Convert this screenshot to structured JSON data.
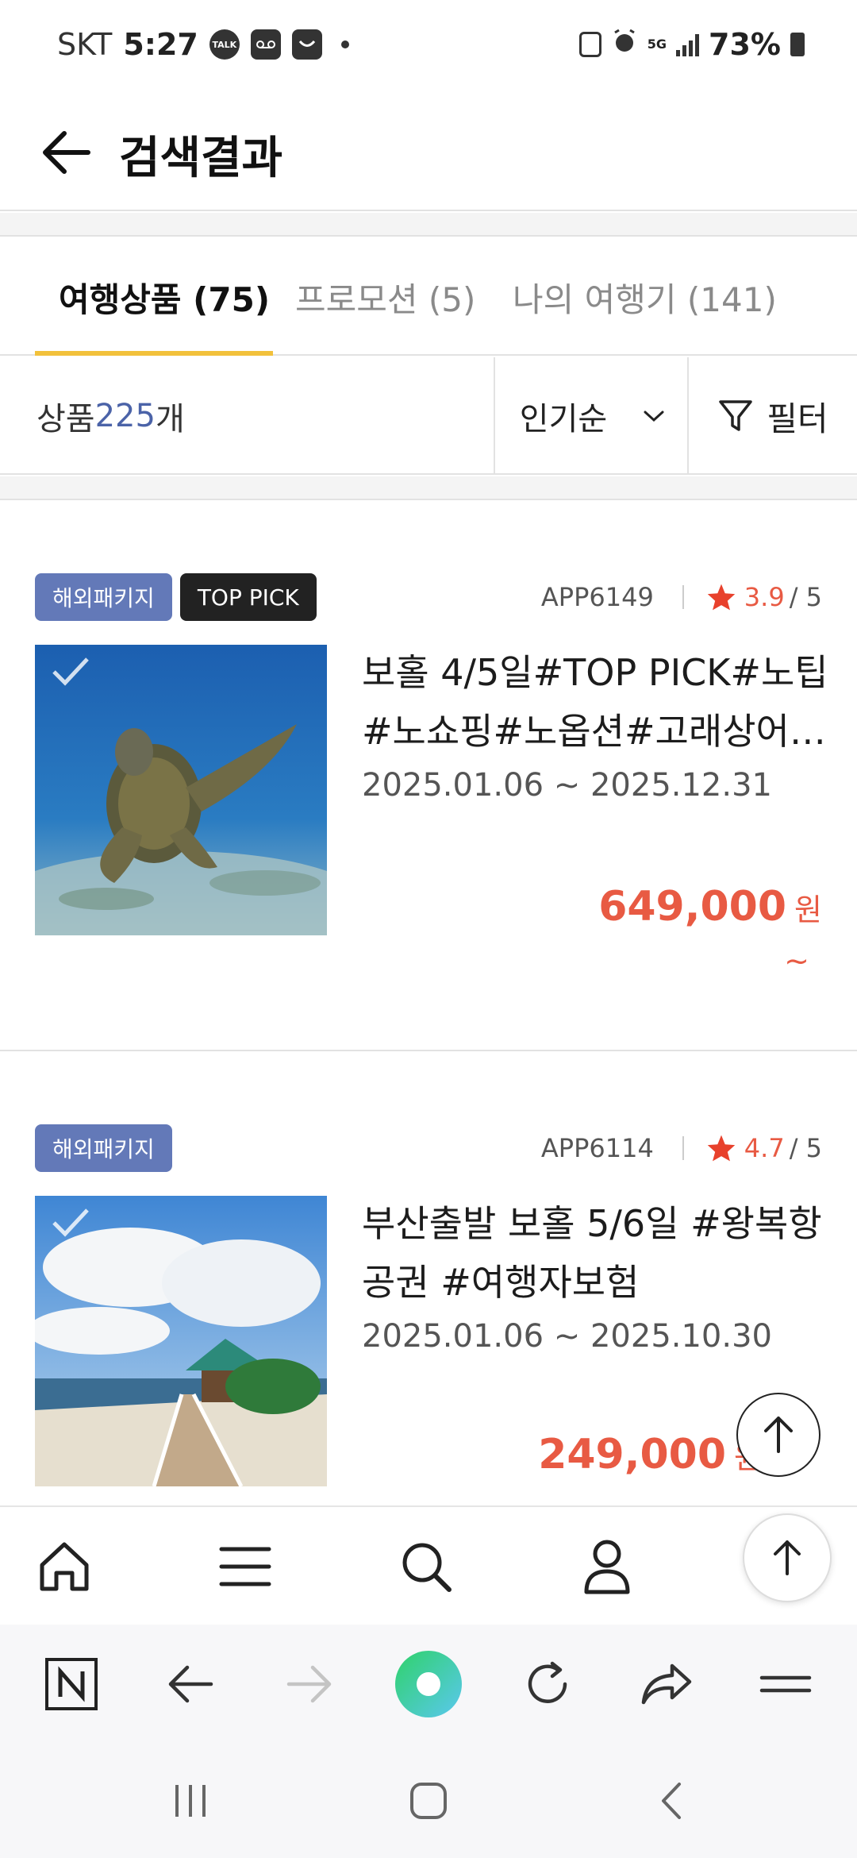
{
  "status_bar": {
    "carrier": "SKT",
    "time": "5:27",
    "talk_icon_text": "TALK",
    "network": "5G",
    "battery": "73%"
  },
  "header": {
    "title": "검색결과"
  },
  "tabs": [
    {
      "label": "여행상품 (75)",
      "active": true
    },
    {
      "label": "프로모션 (5)",
      "active": false
    },
    {
      "label": "나의 여행기 (141)",
      "active": false
    }
  ],
  "controls": {
    "count_prefix": "상품 ",
    "count_value": "225",
    "count_suffix": "개",
    "sort_label": "인기순",
    "filter_label": "필터"
  },
  "products": [
    {
      "badges": [
        "해외패키지",
        "TOP PICK"
      ],
      "code": "APP6149",
      "rating": "3.9",
      "rating_max": "/ 5",
      "title_line1": "보홀 4/5일#TOP PICK#노팁",
      "title_line2": "#노쇼핑#노옵션#고래상어…",
      "dates": "2025.01.06 ~ 2025.12.31",
      "price": "649,000",
      "currency": "원",
      "price_suffix": "~"
    },
    {
      "badges": [
        "해외패키지"
      ],
      "code": "APP6114",
      "rating": "4.7",
      "rating_max": "/ 5",
      "title_line1": "부산출발 보홀 5/6일 #왕복항",
      "title_line2": "공권 #여행자보험",
      "dates": "2025.01.06 ~ 2025.10.30",
      "price": "249,000",
      "currency": "원"
    }
  ],
  "colors": {
    "accent_yellow": "#f2c13b",
    "price_red": "#e85a43",
    "badge_blue": "#6379b8",
    "count_blue": "#4b63a8"
  },
  "icons": {
    "app_nav": [
      "home-icon",
      "menu-icon",
      "search-icon",
      "user-icon"
    ],
    "browser": [
      "naver-icon",
      "back-arrow-icon",
      "forward-arrow-icon",
      "green-dot-icon",
      "refresh-icon",
      "share-icon",
      "more-menu-icon"
    ],
    "system": [
      "recent-apps-icon",
      "home-square-icon",
      "system-back-icon"
    ]
  }
}
